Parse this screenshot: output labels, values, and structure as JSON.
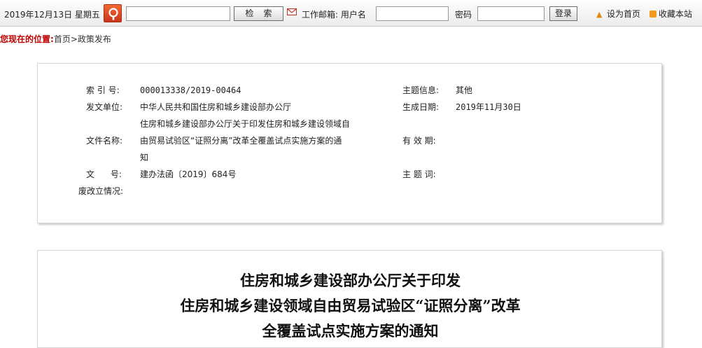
{
  "topbar": {
    "date": "2019年12月13日  星期五",
    "search_placeholder": "",
    "search_button": "检索",
    "mail_label": "工作邮箱: 用户名",
    "username_value": "",
    "password_label": "密码",
    "password_value": "",
    "login_button": "登录",
    "set_home": "设为首页",
    "bookmark": "收藏本站"
  },
  "breadcrumb": {
    "label": "您现在的位置:",
    "items": [
      "首页",
      ">",
      "政策发布"
    ]
  },
  "meta": {
    "index_label": "索 引 号:",
    "index_value": "000013338/2019-00464",
    "topic_label": "主题信息:",
    "topic_value": "其他",
    "issuer_label": "发文单位:",
    "issuer_value": "中华人民共和国住房和城乡建设部办公厅",
    "date_label": "生成日期:",
    "date_value": "2019年11月30日",
    "name_label": "文件名称:",
    "name_line1": "住房和城乡建设部办公厅关于印发住房和城乡建设领域自",
    "name_line2": "由贸易试验区“证照分离”改革全覆盖试点实施方案的通",
    "name_line3": "知",
    "validity_label": "有 效 期:",
    "validity_value": "",
    "docno_label": "文      号:",
    "docno_value": "建办法函〔2019〕684号",
    "keywords_label": "主 题 词:",
    "keywords_value": "",
    "abolish_label": "废改立情况:",
    "abolish_value": ""
  },
  "article": {
    "title_line1": "住房和城乡建设部办公厅关于印发",
    "title_line2": "住房和城乡建设领域自由贸易试验区“证照分离”改革",
    "title_line3": "全覆盖试点实施方案的通知"
  }
}
